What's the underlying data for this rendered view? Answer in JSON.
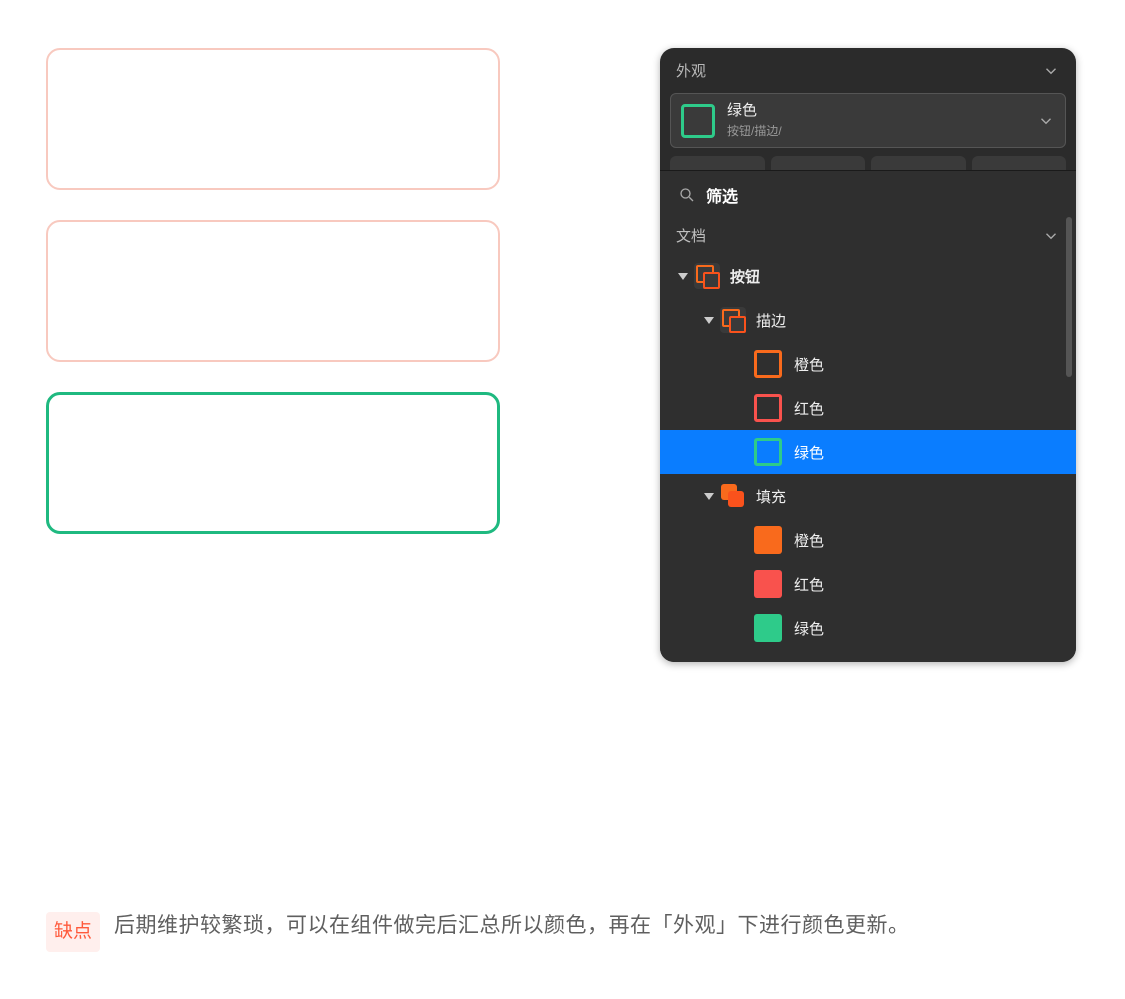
{
  "canvas": {
    "boxes": [
      {
        "style": "pink"
      },
      {
        "style": "pink"
      },
      {
        "style": "green"
      }
    ]
  },
  "panel": {
    "title": "外观",
    "selected_color": {
      "name": "绿色",
      "path": "按钮/描边/"
    },
    "search_label": "筛选",
    "section_label": "文档",
    "tree": {
      "root": {
        "label": "按钮",
        "children": [
          {
            "label": "描边",
            "items": [
              {
                "label": "橙色",
                "swatch": "orange-outline",
                "selected": false
              },
              {
                "label": "红色",
                "swatch": "red-outline",
                "selected": false
              },
              {
                "label": "绿色",
                "swatch": "green-outline",
                "selected": true
              }
            ]
          },
          {
            "label": "填充",
            "items": [
              {
                "label": "橙色",
                "swatch": "orange-fill",
                "selected": false
              },
              {
                "label": "红色",
                "swatch": "red-fill",
                "selected": false
              },
              {
                "label": "绿色",
                "swatch": "green-fill",
                "selected": false
              }
            ]
          }
        ]
      }
    }
  },
  "caption": {
    "badge": "缺点",
    "text": "后期维护较繁琐，可以在组件做完后汇总所以颜色，再在「外观」下进行颜色更新。"
  }
}
